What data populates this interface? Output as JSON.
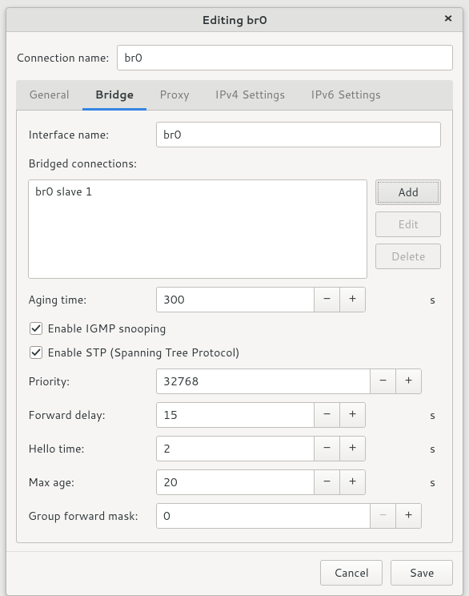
{
  "title": "Editing br0",
  "connection_name_label": "Connection name:",
  "connection_name_value": "br0",
  "tabs": {
    "general": "General",
    "bridge": "Bridge",
    "proxy": "Proxy",
    "ipv4": "IPv4 Settings",
    "ipv6": "IPv6 Settings"
  },
  "bridge": {
    "interface_name_label": "Interface name:",
    "interface_name_value": "br0",
    "bridged_label": "Bridged connections:",
    "connections": [
      "br0 slave 1"
    ],
    "add": "Add",
    "edit": "Edit",
    "delete": "Delete",
    "aging_label": "Aging time:",
    "aging_value": "300",
    "aging_unit": "s",
    "igmp_label": "Enable IGMP snooping",
    "stp_label": "Enable STP (Spanning Tree Protocol)",
    "priority_label": "Priority:",
    "priority_value": "32768",
    "forward_delay_label": "Forward delay:",
    "forward_delay_value": "15",
    "forward_delay_unit": "s",
    "hello_label": "Hello time:",
    "hello_value": "2",
    "hello_unit": "s",
    "maxage_label": "Max age:",
    "maxage_value": "20",
    "maxage_unit": "s",
    "gfm_label": "Group forward mask:",
    "gfm_value": "0"
  },
  "footer": {
    "cancel": "Cancel",
    "save": "Save"
  }
}
